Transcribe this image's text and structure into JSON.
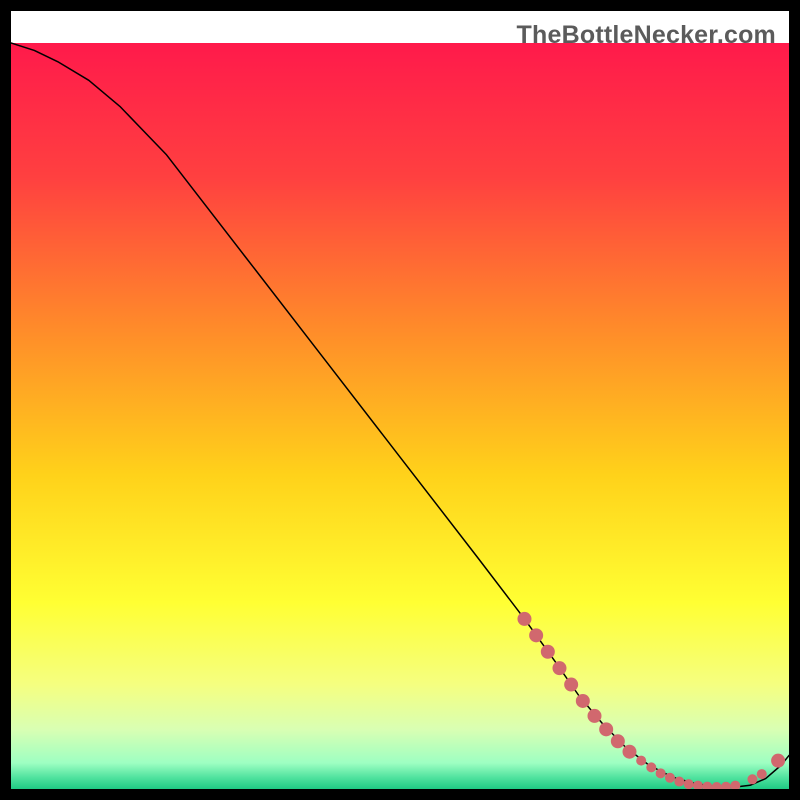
{
  "watermark": "TheBottleNecker.com",
  "chart_data": {
    "type": "line",
    "title": "",
    "xlabel": "",
    "ylabel": "",
    "xlim": [
      0,
      100
    ],
    "ylim": [
      0,
      100
    ],
    "background": {
      "type": "vertical-gradient",
      "stops": [
        {
          "pos": 0.0,
          "color": "#ff1a4b"
        },
        {
          "pos": 0.18,
          "color": "#ff4040"
        },
        {
          "pos": 0.38,
          "color": "#ff8a2a"
        },
        {
          "pos": 0.58,
          "color": "#ffd21a"
        },
        {
          "pos": 0.75,
          "color": "#ffff33"
        },
        {
          "pos": 0.86,
          "color": "#f5ff80"
        },
        {
          "pos": 0.92,
          "color": "#d9ffb3"
        },
        {
          "pos": 0.965,
          "color": "#9effc2"
        },
        {
          "pos": 0.985,
          "color": "#4fe29e"
        },
        {
          "pos": 1.0,
          "color": "#1fca84"
        }
      ]
    },
    "series": [
      {
        "name": "bottleneck-curve",
        "color": "#000000",
        "width": 1.5,
        "x": [
          0,
          3,
          6,
          10,
          14,
          20,
          30,
          40,
          50,
          60,
          66,
          70,
          73,
          76,
          79,
          82,
          85,
          88,
          91,
          93,
          95,
          97,
          99,
          100
        ],
        "y": [
          100,
          99,
          97.5,
          95,
          91.5,
          85,
          71.5,
          58,
          44.5,
          31,
          22.8,
          17,
          12.5,
          8.8,
          5.6,
          3.2,
          1.6,
          0.7,
          0.3,
          0.25,
          0.5,
          1.4,
          3.2,
          4.5
        ]
      }
    ],
    "markers": {
      "name": "highlighted-range",
      "color": "#d1686e",
      "radius_large": 7,
      "radius_small": 5,
      "points": [
        {
          "x": 66.0,
          "y": 22.8,
          "r": "l"
        },
        {
          "x": 67.5,
          "y": 20.6,
          "r": "l"
        },
        {
          "x": 69.0,
          "y": 18.4,
          "r": "l"
        },
        {
          "x": 70.5,
          "y": 16.2,
          "r": "l"
        },
        {
          "x": 72.0,
          "y": 14.0,
          "r": "l"
        },
        {
          "x": 73.5,
          "y": 11.8,
          "r": "l"
        },
        {
          "x": 75.0,
          "y": 9.8,
          "r": "l"
        },
        {
          "x": 76.5,
          "y": 8.0,
          "r": "l"
        },
        {
          "x": 78.0,
          "y": 6.4,
          "r": "l"
        },
        {
          "x": 79.5,
          "y": 5.0,
          "r": "l"
        },
        {
          "x": 81.0,
          "y": 3.8,
          "r": "s"
        },
        {
          "x": 82.3,
          "y": 2.9,
          "r": "s"
        },
        {
          "x": 83.5,
          "y": 2.1,
          "r": "s"
        },
        {
          "x": 84.7,
          "y": 1.5,
          "r": "s"
        },
        {
          "x": 85.9,
          "y": 1.0,
          "r": "s"
        },
        {
          "x": 87.1,
          "y": 0.65,
          "r": "s"
        },
        {
          "x": 88.3,
          "y": 0.45,
          "r": "s"
        },
        {
          "x": 89.5,
          "y": 0.32,
          "r": "s"
        },
        {
          "x": 90.7,
          "y": 0.27,
          "r": "s"
        },
        {
          "x": 91.9,
          "y": 0.3,
          "r": "s"
        },
        {
          "x": 93.1,
          "y": 0.45,
          "r": "s"
        },
        {
          "x": 95.3,
          "y": 1.3,
          "r": "s"
        },
        {
          "x": 96.5,
          "y": 2.0,
          "r": "s"
        },
        {
          "x": 98.6,
          "y": 3.8,
          "r": "l"
        }
      ]
    }
  }
}
